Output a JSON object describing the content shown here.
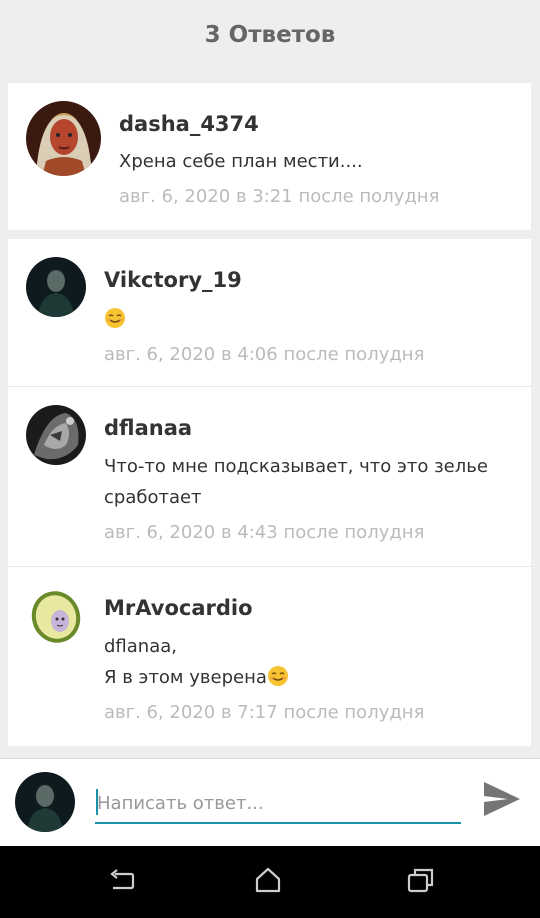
{
  "header": {
    "title": "3 Ответов"
  },
  "parent_comment": {
    "author": "dasha_4374",
    "text": "Хрена себе план мести....",
    "time": "авг. 6, 2020 в 3:21 после полудня"
  },
  "replies": [
    {
      "author": "Vikctory_19",
      "text": "",
      "emoji": "smiling-face-emoji",
      "time": "авг. 6, 2020 в 4:06 после полудня"
    },
    {
      "author": "dflanaa",
      "text": "Что-то мне подсказывает, что это зелье сработает",
      "time": "авг. 6, 2020 в 4:43 после полудня"
    },
    {
      "author": "MrAvocardio",
      "line1": "dflanaa,",
      "line2": "Я в этом уверена",
      "emoji": "smiling-face-emoji",
      "time": "авг. 6, 2020 в 7:17 после полудня"
    }
  ],
  "reply_bar": {
    "placeholder": "Написать ответ...",
    "send_icon": "send-icon"
  },
  "navbar": {
    "icons": [
      "back-icon",
      "home-icon",
      "recent-apps-icon"
    ]
  },
  "colors": {
    "accent": "#1a93a8",
    "timestamp": "#bbbbbb",
    "background": "#eeeeee"
  }
}
